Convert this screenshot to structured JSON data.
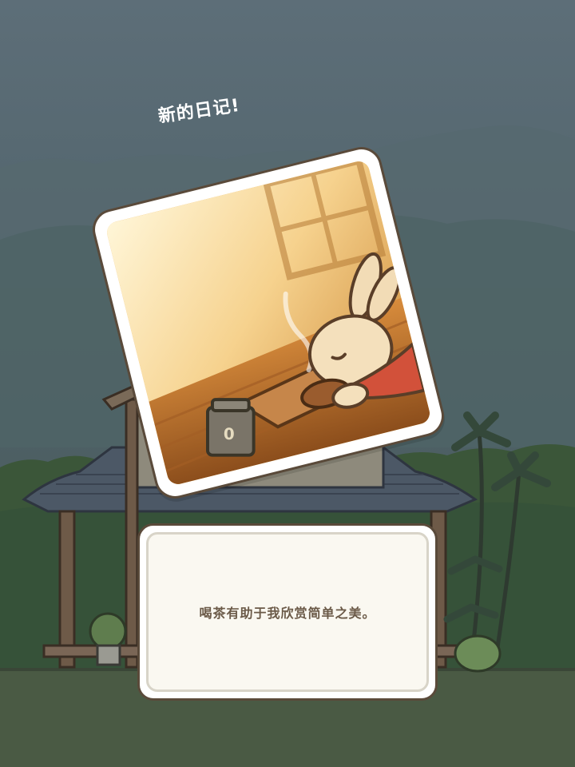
{
  "headline": "新的日记!",
  "diary": {
    "text": "喝茶有助于我欣赏简单之美。"
  },
  "photo": {
    "subject": "rabbit-drinking-tea",
    "tea_can_label": "0"
  },
  "colors": {
    "sky_top": "#5d6e78",
    "forest": "#3d5a3c",
    "ground": "#4a5a44",
    "card_border": "#5a4a3a",
    "text_brown": "#6b5a48",
    "scarf_red": "#d2513a"
  }
}
